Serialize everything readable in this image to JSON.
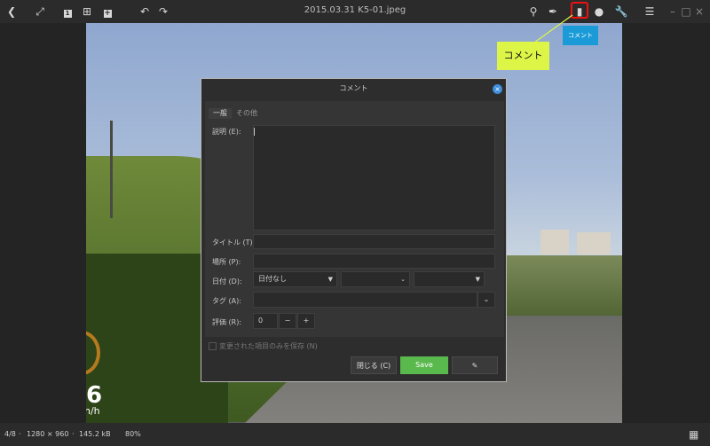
{
  "window": {
    "title": "2015.03.31 K5-01.jpeg"
  },
  "toolbar": {
    "left_icons": [
      "back-icon",
      "fullscreen-icon",
      "single-view-icon",
      "grid-view-icon",
      "add-icon",
      "rotate-left-icon",
      "rotate-right-icon"
    ],
    "right_icons": [
      "location-icon",
      "edit-brush-icon",
      "comment-icon",
      "tags-icon",
      "tools-icon",
      "menu-icon",
      "minimize-icon",
      "maximize-icon",
      "close-icon"
    ]
  },
  "tooltip": {
    "text": "コメント"
  },
  "callout": {
    "text": "コメント"
  },
  "photo": {
    "speed_value": "6",
    "speed_unit": "n/h"
  },
  "dialog": {
    "title": "コメント",
    "tabs": [
      "一般",
      "その他"
    ],
    "labels": {
      "description": "説明 (E):",
      "title": "タイトル (T):",
      "place": "場所 (P):",
      "date": "日付 (D):",
      "tags": "タグ (A):",
      "rating": "評価 (R):"
    },
    "date_select": "日付なし",
    "rating_value": "0",
    "rating_minus": "−",
    "rating_plus": "+",
    "save_changed_only": "変更された項目のみを保存 (N)",
    "buttons": {
      "close": "閉じる (C)",
      "save": "Save",
      "pin": "✎"
    },
    "colors": {
      "accent": "#3d8edc",
      "save": "#5ab94d"
    }
  },
  "status": {
    "position": "4/8",
    "resolution": "1280 × 960",
    "size": "145.2 kB",
    "zoom": "80%",
    "sep": "·"
  }
}
